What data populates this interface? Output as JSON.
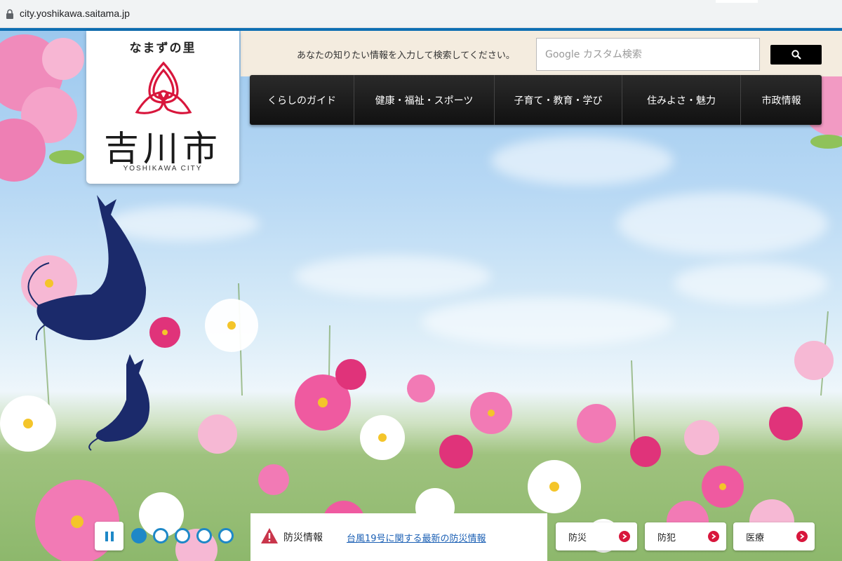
{
  "browser": {
    "url": "city.yoshikawa.saitama.jp"
  },
  "logo": {
    "tagline": "なまずの里",
    "city_name": "吉川市",
    "city_roman": "YOSHIKAWA CITY"
  },
  "search": {
    "label": "あなたの知りたい情報を入力して検索してください。",
    "placeholder": "Google カスタム検索",
    "button_icon": "search-icon"
  },
  "nav": {
    "items": [
      {
        "label": "くらしのガイド"
      },
      {
        "label": "健康・福祉・スポーツ"
      },
      {
        "label": "子育て・教育・学び"
      },
      {
        "label": "住みよさ・魅力"
      },
      {
        "label": "市政情報"
      }
    ]
  },
  "slider": {
    "pause_icon": "pause-icon",
    "slide_count": 5,
    "active_slide": 1
  },
  "disaster_info": {
    "title": "防災情報",
    "link_text": "台風19号に関する最新の防災情報",
    "icon": "warning-icon"
  },
  "quick_links": [
    {
      "label": "防災"
    },
    {
      "label": "防犯"
    },
    {
      "label": "医療"
    }
  ],
  "colors": {
    "accent_blue": "#1e88c7",
    "nav_bg": "#1a1a1a",
    "search_band": "#f4ecdf",
    "emblem_red": "#d8163c",
    "catfish_navy": "#1b2a6b"
  }
}
